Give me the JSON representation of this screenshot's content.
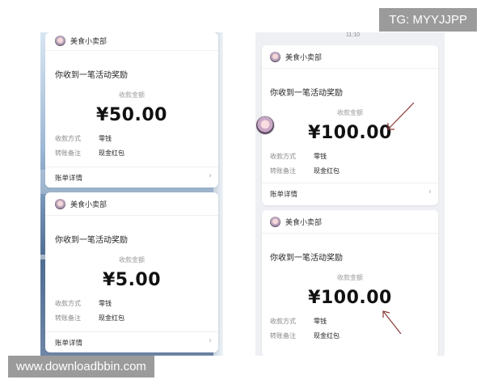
{
  "left": {
    "card1": {
      "store": "美食小卖部",
      "title": "你收到一笔活动奖励",
      "amount_label": "收款金额",
      "amount": "¥50.00",
      "method_label": "收款方式",
      "method_value": "零钱",
      "note_label": "转账备注",
      "note_value": "现金红包",
      "details": "账单详情"
    },
    "card2": {
      "store": "美食小卖部",
      "title": "你收到一笔活动奖励",
      "amount_label": "收款金额",
      "amount": "¥5.00",
      "method_label": "收款方式",
      "method_value": "零钱",
      "note_label": "转账备注",
      "note_value": "现金红包",
      "details": "账单详情"
    }
  },
  "right": {
    "time": "11:10",
    "card1": {
      "store": "美食小卖部",
      "title": "你收到一笔活动奖励",
      "amount_label": "收款金额",
      "amount": "¥100.00",
      "method_label": "收款方式",
      "method_value": "零钱",
      "note_label": "转账备注",
      "note_value": "现金红包",
      "details": "账单详情"
    },
    "card2": {
      "store": "美食小卖部",
      "title": "你收到一笔活动奖励",
      "amount_label": "收款金额",
      "amount": "¥100.00",
      "method_label": "收款方式",
      "method_value": "零钱",
      "note_label": "转账备注",
      "note_value": "现金红包"
    }
  },
  "watermarks": {
    "top": "TG: MYYJJPP",
    "bottom": "www.downloadbbin.com"
  },
  "colors": {
    "arrow": "#8b3a3a",
    "badge_bg": "#9b9b9b"
  }
}
